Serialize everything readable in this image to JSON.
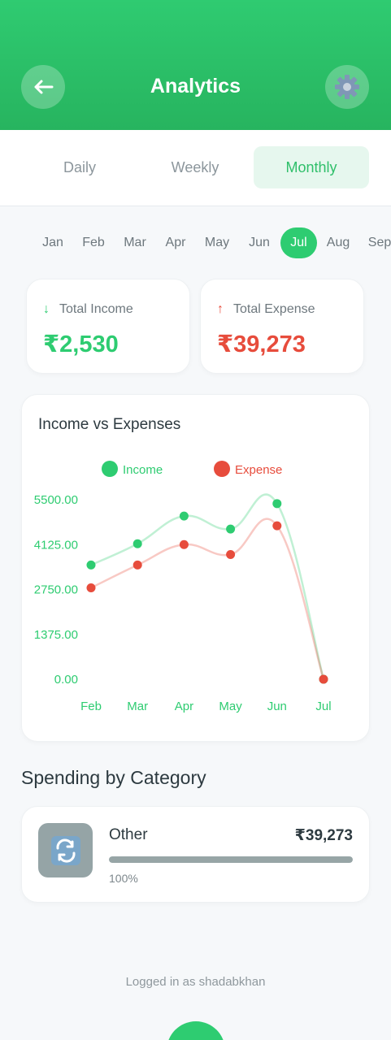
{
  "header": {
    "title": "Analytics",
    "back_icon": "arrow-left-icon",
    "settings_icon": "gear-icon"
  },
  "tabs": [
    {
      "label": "Daily",
      "active": false
    },
    {
      "label": "Weekly",
      "active": false
    },
    {
      "label": "Monthly",
      "active": true
    }
  ],
  "months": [
    "Jan",
    "Feb",
    "Mar",
    "Apr",
    "May",
    "Jun",
    "Jul",
    "Aug",
    "Sep"
  ],
  "selected_month": "Jul",
  "summary": {
    "income": {
      "label": "Total Income",
      "value": "₹2,530",
      "icon": "↓"
    },
    "expense": {
      "label": "Total Expense",
      "value": "₹39,273",
      "icon": "↑"
    }
  },
  "colors": {
    "accent": "#2ecc71",
    "income": "#2ecc71",
    "expense": "#e74c3c",
    "category": "#95a5a6"
  },
  "chart_data": {
    "type": "line",
    "title": "Income vs Expenses",
    "categories": [
      "Feb",
      "Mar",
      "Apr",
      "May",
      "Jun",
      "Jul"
    ],
    "series": [
      {
        "name": "Income",
        "values": [
          3500,
          4150,
          5000,
          4600,
          5380,
          0
        ]
      },
      {
        "name": "Expense",
        "values": [
          2800,
          3500,
          4125,
          3820,
          4700,
          0
        ]
      }
    ],
    "yticks": [
      "5500.00",
      "4125.00",
      "2750.00",
      "1375.00",
      "0.00"
    ],
    "ylim": [
      0,
      5500
    ],
    "legend_position": "top-center",
    "grid": false
  },
  "spending": {
    "title": "Spending by Category",
    "items": [
      {
        "name": "Other",
        "amount": "₹39,273",
        "percent_label": "100%",
        "fraction": 1.0,
        "icon": "🔄"
      }
    ]
  },
  "footer": {
    "logged_in": "Logged in as shadabkhan"
  }
}
